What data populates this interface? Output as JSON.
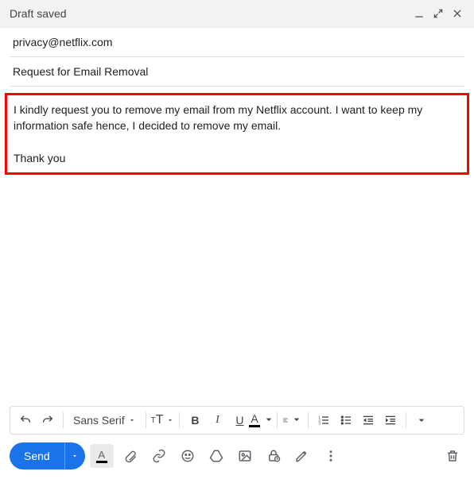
{
  "window": {
    "title": "Draft saved"
  },
  "email": {
    "to": "privacy@netflix.com",
    "subject": "Request for Email Removal",
    "body": "I kindly request you to remove my email from my Netflix account. I want to keep my information safe hence, I decided to remove my email.\n\nThank you"
  },
  "format_bar": {
    "font": "Sans Serif"
  },
  "actions": {
    "send_label": "Send"
  }
}
